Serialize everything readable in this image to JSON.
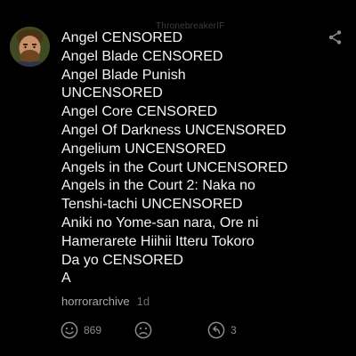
{
  "watermark": "ThronebreakerIF",
  "comment": {
    "lines": [
      "Angel CENSORED",
      "Angel Blade CENSORED",
      "Angel Blade Punish",
      "UNCENSORED",
      "Angel Core CENSORED",
      "Angel Of Darkness UNCENSORED",
      "Angelium UNCENSORED",
      "Angels in the Court UNCENSORED",
      "Angels in the Court 2: Naka no",
      "Tenshi-tachi UNCENSORED",
      "Aniki no Yome-san nara, Ore ni",
      "Hamerarete Hiihii Itteru Tokoro",
      "Da yo CENSORED",
      "A"
    ]
  },
  "meta": {
    "username": "horrorarchive",
    "time": "1d"
  },
  "actions": {
    "like_count": "869",
    "reply_count": "3"
  },
  "icons": {
    "avatar": "user-avatar",
    "share": "share-icon",
    "like": "smiley-icon",
    "dislike": "frown-icon",
    "reply": "reply-icon"
  },
  "colors": {
    "background": "#000000",
    "text": "#f4f4f4",
    "muted": "#a8a8a8",
    "icon": "#8a8a8a"
  }
}
